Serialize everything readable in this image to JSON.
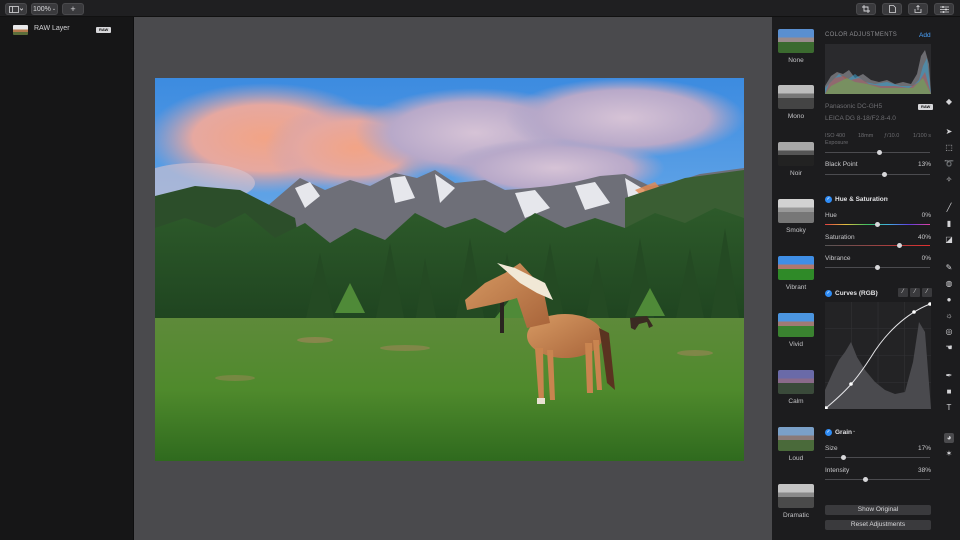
{
  "toolbar": {
    "view_icon": "sidebar-icon",
    "zoom": "100%",
    "add_label": "+",
    "right_icons": [
      "crop-icon",
      "document-icon",
      "share-icon",
      "export-icon",
      "adjust-icon"
    ]
  },
  "layers": {
    "items": [
      {
        "name": "RAW Layer",
        "badge": "RAW"
      }
    ]
  },
  "presets": {
    "items": [
      {
        "label": "None"
      },
      {
        "label": "Mono"
      },
      {
        "label": "Noir"
      },
      {
        "label": "Smoky"
      },
      {
        "label": "Vibrant"
      },
      {
        "label": "Vivid"
      },
      {
        "label": "Calm"
      },
      {
        "label": "Loud"
      },
      {
        "label": "Dramatic"
      }
    ]
  },
  "adjust": {
    "title": "COLOR ADJUSTMENTS",
    "add_label": "Add",
    "raw_badge": "RAW",
    "camera": "Panasonic DC-GH5",
    "lens": "LEICA DG 8-18/F2.8-4.0",
    "exif": {
      "iso": "ISO 400",
      "focal": "18mm",
      "aperture": "ƒ/10.0",
      "shutter": "1/100 s"
    },
    "exposure_label": "Exposure",
    "black_point": {
      "label": "Black Point",
      "value": "13%",
      "level": 0.55
    },
    "hue_sat": {
      "title": "Hue & Saturation",
      "hue": {
        "label": "Hue",
        "value": "0%",
        "level": 0.5
      },
      "saturation": {
        "label": "Saturation",
        "value": "40%",
        "level": 0.7
      },
      "vibrance": {
        "label": "Vibrance",
        "value": "0%",
        "level": 0.5
      }
    },
    "curves": {
      "title": "Curves (RGB)"
    },
    "grain": {
      "title": "Grain",
      "size": {
        "label": "Size",
        "value": "17%",
        "level": 0.17
      },
      "intensity": {
        "label": "Intensity",
        "value": "38%",
        "level": 0.38
      }
    },
    "show_original": "Show Original",
    "reset": "Reset Adjustments"
  },
  "colors": {
    "accent": "#2f8cf5",
    "link": "#4aa3ff"
  }
}
